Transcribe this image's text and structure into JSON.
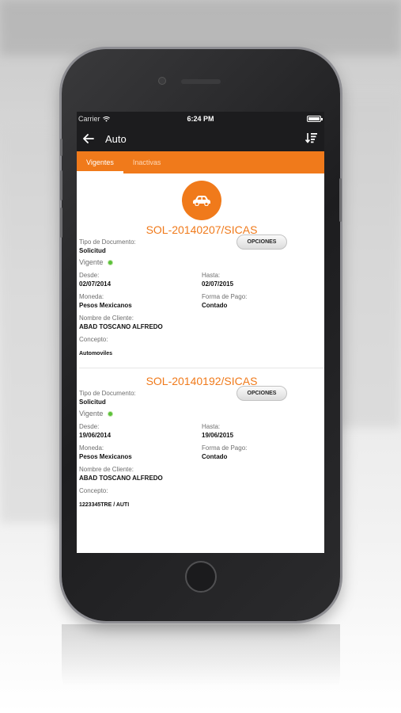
{
  "status_bar": {
    "carrier": "Carrier",
    "time": "6:24 PM"
  },
  "toolbar": {
    "title": "Auto",
    "back_icon": "arrow-left-icon",
    "sort_icon": "sort-icon"
  },
  "tabs": [
    {
      "label": "Vigentes",
      "active": true
    },
    {
      "label": "Inactivas",
      "active": false
    }
  ],
  "accent_color": "#f07a1b",
  "policies": [
    {
      "id": "SOL-20140207/SICAS",
      "tipo_label": "Tipo de Documento:",
      "tipo_value": "Solicitud",
      "estado": "Vigente",
      "options_label": "OPCIONES",
      "desde_label": "Desde:",
      "desde_value": "02/07/2014",
      "hasta_label": "Hasta:",
      "hasta_value": "02/07/2015",
      "moneda_label": "Moneda:",
      "moneda_value": "Pesos Mexicanos",
      "forma_label": "Forma de Pago:",
      "forma_value": "Contado",
      "cliente_label": "Nombre de Cliente:",
      "cliente_value": "ABAD TOSCANO ALFREDO",
      "concepto_label": "Concepto:",
      "concepto_value": "Automoviles"
    },
    {
      "id": "SOL-20140192/SICAS",
      "tipo_label": "Tipo de Documento:",
      "tipo_value": "Solicitud",
      "estado": "Vigente",
      "options_label": "OPCIONES",
      "desde_label": "Desde:",
      "desde_value": "19/06/2014",
      "hasta_label": "Hasta:",
      "hasta_value": "19/06/2015",
      "moneda_label": "Moneda:",
      "moneda_value": "Pesos Mexicanos",
      "forma_label": "Forma de Pago:",
      "forma_value": "Contado",
      "cliente_label": "Nombre de Cliente:",
      "cliente_value": "ABAD TOSCANO ALFREDO",
      "concepto_label": "Concepto:",
      "concepto_value": "1223345TRE / AUTI"
    }
  ]
}
